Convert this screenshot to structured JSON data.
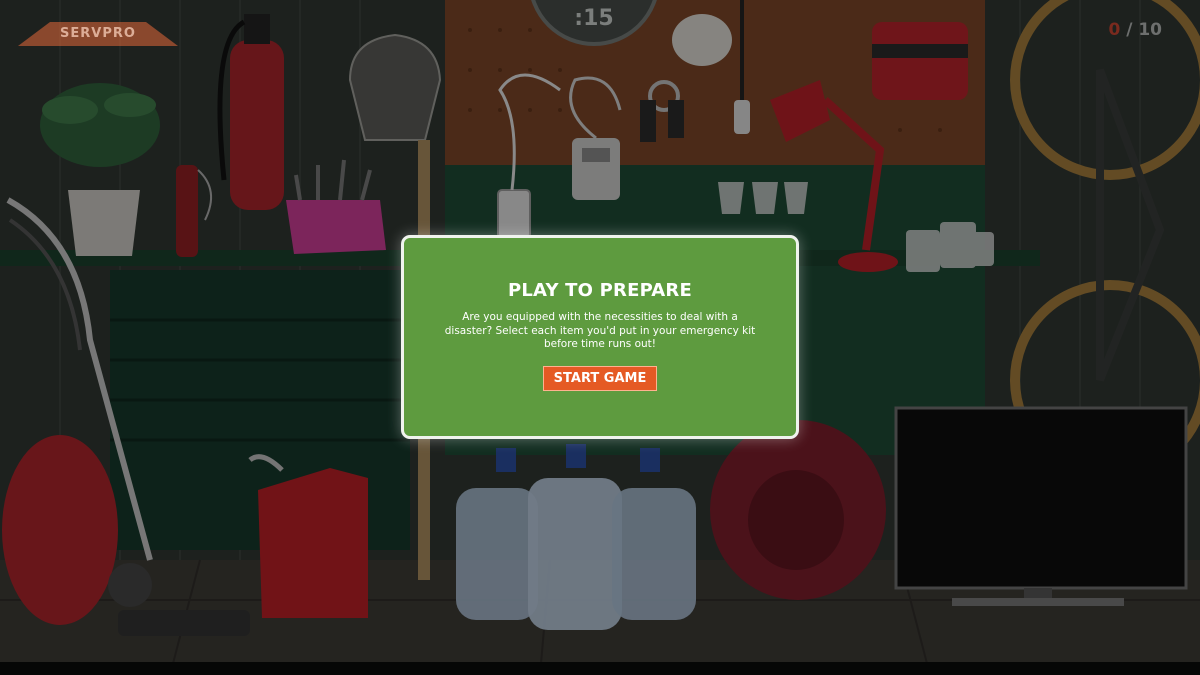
{
  "brand": {
    "logo_text": "SERVPRO"
  },
  "timer": {
    "text": ":15"
  },
  "score": {
    "found": "0",
    "separator": " / ",
    "total": "10"
  },
  "modal": {
    "title": "PLAY TO PREPARE",
    "line1": "Are you equipped with the necessities to deal with a",
    "line2": "disaster? Select each item you'd put in your emergency kit",
    "line3": "before time runs out!",
    "start_label": "START GAME"
  },
  "scene_items": [
    "potted-plant",
    "fire-extinguisher",
    "flashlight",
    "shovel",
    "pink-toolbox",
    "phone-charger",
    "radio",
    "face-mask",
    "keys",
    "whistle",
    "first-aid-kit",
    "desk-lamp",
    "wine-glasses",
    "glass-jars",
    "bicycle",
    "vacuum-cleaner",
    "gas-can",
    "water-jugs",
    "sleeping-bag",
    "tv-monitor"
  ],
  "colors": {
    "modal_bg": "#5e9b3f",
    "button": "#e55a24",
    "logo": "#e46a3a"
  }
}
